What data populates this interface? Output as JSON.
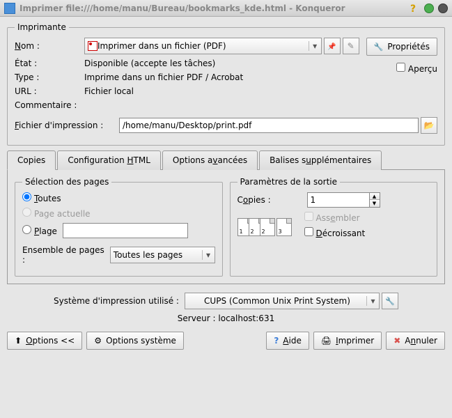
{
  "title": "Imprimer file:///home/manu/Bureau/bookmarks_kde.html - Konqueror",
  "printer": {
    "legend": "Imprimante",
    "name_label": "Nom :",
    "name_value": "Imprimer dans un fichier (PDF)",
    "state_label": "État :",
    "state_value": "Disponible (accepte les tâches)",
    "type_label": "Type :",
    "type_value": "Imprime dans un fichier PDF / Acrobat",
    "url_label": "URL :",
    "url_value": "Fichier local",
    "comment_label": "Commentaire :",
    "comment_value": "",
    "properties_btn": "Propriétés",
    "preview_label": "Aperçu",
    "outfile_label": "Fichier d'impression :",
    "outfile_value": "/home/manu/Desktop/print.pdf"
  },
  "tabs": {
    "copies": "Copies",
    "html": "Configuration HTML",
    "advanced": "Options avancées",
    "extra": "Balises supplémentaires"
  },
  "pagesel": {
    "legend": "Sélection des pages",
    "all": "Toutes",
    "current": "Page actuelle",
    "range": "Plage",
    "set_label": "Ensemble de pages :",
    "set_value": "Toutes les pages"
  },
  "output": {
    "legend": "Paramètres de la sortie",
    "copies_label": "Copies :",
    "copies_value": "1",
    "collate": "Assembler",
    "reverse": "Décroissant"
  },
  "system": {
    "label": "Système d'impression utilisé :",
    "value": "CUPS (Common Unix Print System)",
    "server": "Serveur : localhost:631"
  },
  "buttons": {
    "options": "Options <<",
    "sysoptions": "Options système",
    "help": "Aide",
    "print": "Imprimer",
    "cancel": "Annuler"
  }
}
